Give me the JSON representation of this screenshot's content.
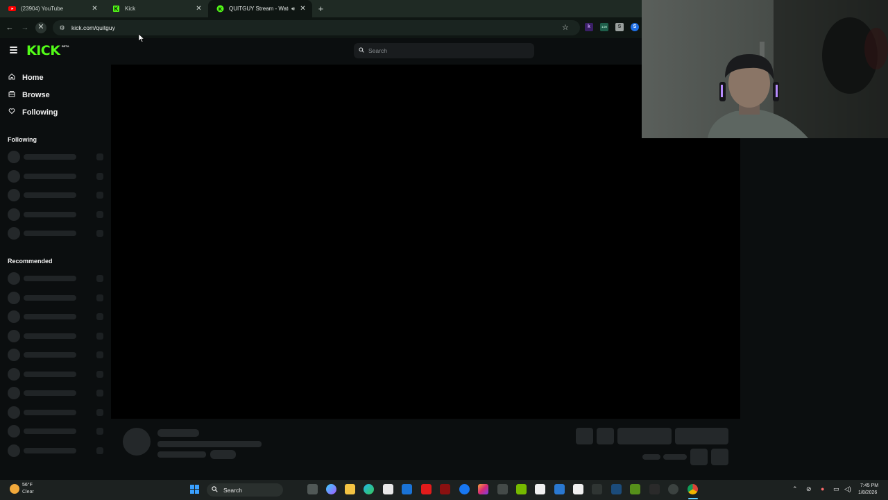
{
  "browser": {
    "tabs": [
      {
        "title": "(23904) YouTube",
        "favicon": "youtube-icon",
        "favicon_color": "#ff0000",
        "active": false
      },
      {
        "title": "Kick",
        "favicon": "kick-icon",
        "favicon_color": "#53fc18",
        "active": false
      },
      {
        "title": "QUITGUY Stream - Watch Li",
        "favicon": "kick-icon",
        "favicon_color": "#53fc18",
        "active": true
      }
    ],
    "new_tab_label": "+",
    "url": "kick.com/quitguy",
    "extensions": [
      {
        "name": "kick-extension-icon",
        "label": "k",
        "color": "#7a3bd6"
      },
      {
        "name": "counter-extension-icon",
        "label": "1.00",
        "color": "#2d8f6f"
      },
      {
        "name": "puzzle-extension-icon",
        "label": "S",
        "color": "#b8bcbb"
      },
      {
        "name": "shazam-extension-icon",
        "label": "S",
        "color": "#1f6fe5"
      }
    ]
  },
  "kick": {
    "logo": "KICK",
    "logo_badge": "BETA",
    "search_placeholder": "Search",
    "nav": [
      {
        "label": "Home",
        "icon": "home-icon"
      },
      {
        "label": "Browse",
        "icon": "browse-icon"
      },
      {
        "label": "Following",
        "icon": "heart-icon"
      }
    ],
    "following_heading": "Following",
    "recommended_heading": "Recommended",
    "following_placeholder_rows": 5,
    "recommended_placeholder_rows": 10
  },
  "taskbar": {
    "weather_temp": "56°F",
    "weather_condition": "Clear",
    "search_label": "Search",
    "time": "7:45 PM",
    "date": "1/8/2026"
  },
  "colors": {
    "kick_green": "#53fc18",
    "page_bg": "#0b0e0f",
    "skeleton": "#24282a"
  }
}
